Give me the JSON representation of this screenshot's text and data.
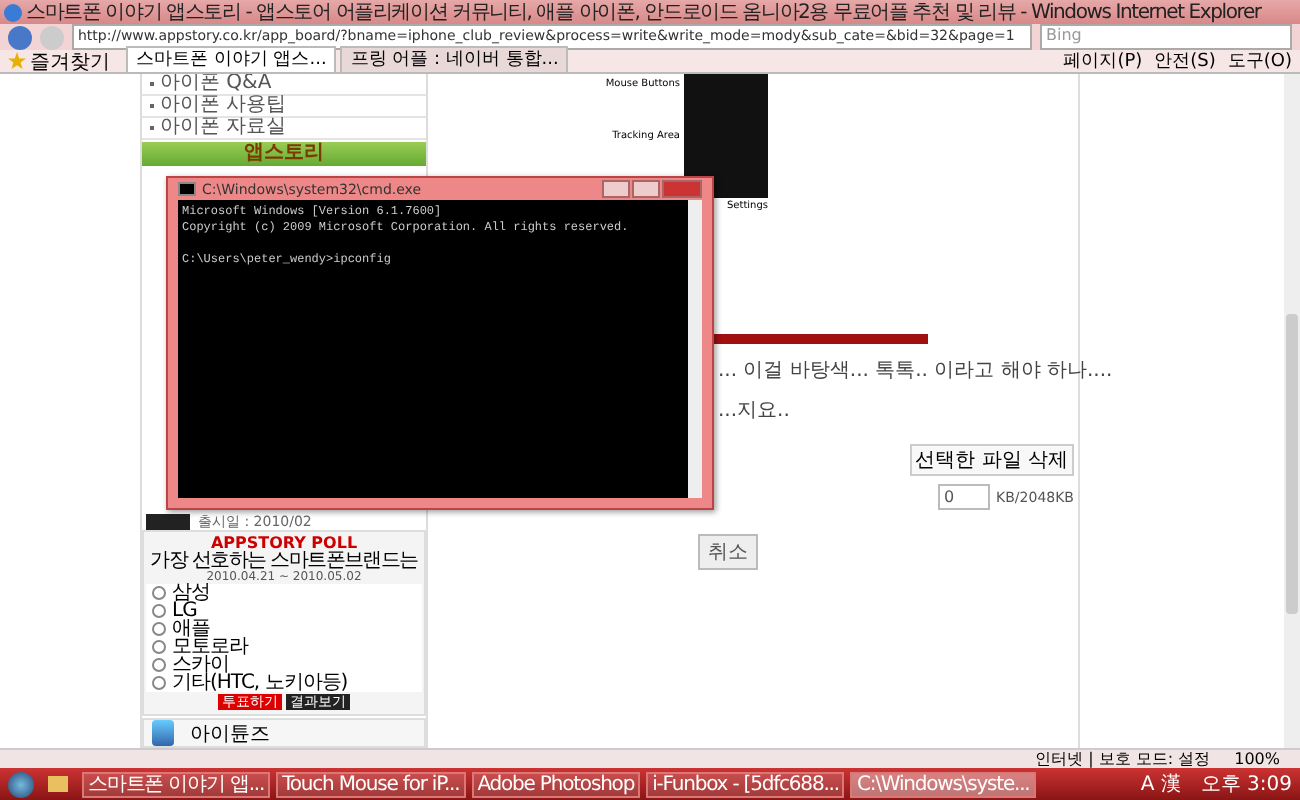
{
  "window": {
    "title": "스마트폰 이야기 앱스토리 - 앱스토어 어플리케이션 커뮤니티, 애플 아이폰, 안드로이드 옴니아2용 무료어플 추천 및 리뷰 - Windows Internet Explorer"
  },
  "address_bar": {
    "url": "http://www.appstory.co.kr/app_board/?bname=iphone_club_review&process=write&write_mode=mody&sub_cate=&bid=32&page=1",
    "search_placeholder": "Bing"
  },
  "favorites_label": "즐겨찾기",
  "tabs": [
    {
      "label": "스마트폰 이야기 앱스...",
      "selected": true
    },
    {
      "label": "프링 어플 : 네이버 통합...",
      "selected": false
    }
  ],
  "command_bar": [
    "페이지(P)",
    "안전(S)",
    "도구(O)"
  ],
  "sidebar": {
    "items": [
      "아이폰 Q&A",
      "아이폰 사용팁",
      "아이폰 자료실"
    ],
    "banner": "앱스토리",
    "release_date": "출시일 : 2010/02"
  },
  "poll": {
    "title": "APPSTORY POLL",
    "question": "가장 선호하는 스마트폰브랜드는",
    "period": "2010.04.21 ~ 2010.05.02",
    "options": [
      {
        "label": "삼성",
        "selected": false
      },
      {
        "label": "LG",
        "selected": false
      },
      {
        "label": "애플",
        "selected": false
      },
      {
        "label": "모토로라",
        "selected": false
      },
      {
        "label": "스카이",
        "selected": false
      },
      {
        "label": "기타(HTC, 노키아등)",
        "selected": false
      }
    ],
    "buttons": [
      "투표하기",
      "결과보기"
    ],
    "app_label": "아이튠즈"
  },
  "article": {
    "callouts": [
      "Mouse Buttons",
      "Tracking Area",
      "Settings"
    ],
    "lines": [
      "... 이걸 바탕색... 톡톡.. 이라고 해야 하나....",
      "...지요.."
    ],
    "delete_button": "선택한 파일 삭제",
    "size_value": "0",
    "size_limit": "KB/2048KB",
    "cancel_button": "취소"
  },
  "console": {
    "title": "C:\\Windows\\system32\\cmd.exe",
    "lines": [
      "Microsoft Windows [Version 6.1.7600]",
      "Copyright (c) 2009 Microsoft Corporation. All rights reserved.",
      "C:\\Users\\peter_wendy>ipconfig"
    ]
  },
  "status_bar": {
    "zone": "인터넷 | 보호 모드: 설정",
    "zoom": "100%"
  },
  "taskbar": {
    "items": [
      {
        "label": "스마트폰 이야기 앱...",
        "selected": false
      },
      {
        "label": "Touch Mouse for iP...",
        "selected": false
      },
      {
        "label": "Adobe Photoshop",
        "selected": false
      },
      {
        "label": "i-Funbox - [5dfc688...",
        "selected": false
      },
      {
        "label": "C:\\Windows\\syste...",
        "selected": true
      }
    ],
    "ime": "A 漢",
    "clock": "오후 3:09"
  }
}
